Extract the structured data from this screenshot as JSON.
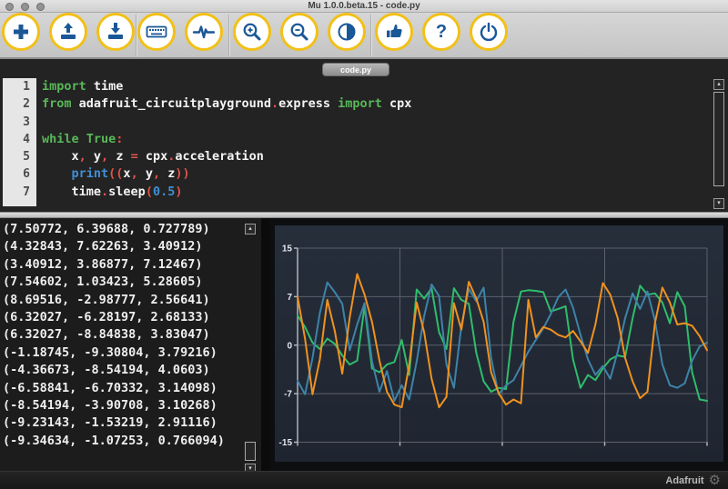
{
  "window": {
    "title": "Mu 1.0.0.beta.15 - code.py",
    "traffic_lights": [
      "close",
      "minimize",
      "zoom"
    ]
  },
  "toolbar": {
    "buttons": [
      {
        "id": "new",
        "icon": "plus-icon"
      },
      {
        "id": "load",
        "icon": "upload-icon"
      },
      {
        "id": "save",
        "icon": "download-icon"
      },
      {
        "id": "serial",
        "icon": "keyboard-icon"
      },
      {
        "id": "plotter",
        "icon": "pulse-icon"
      },
      {
        "id": "zoom-in",
        "icon": "magnifier-plus-icon"
      },
      {
        "id": "zoom-out",
        "icon": "magnifier-minus-icon"
      },
      {
        "id": "theme",
        "icon": "contrast-icon"
      },
      {
        "id": "check",
        "icon": "thumbs-up-icon"
      },
      {
        "id": "help",
        "icon": "question-icon",
        "glyph": "?"
      },
      {
        "id": "quit",
        "icon": "power-icon"
      }
    ]
  },
  "editor": {
    "tab": "code.py",
    "lines": [
      {
        "n": "1",
        "tokens": [
          [
            "k",
            "import"
          ],
          [
            "t",
            " time"
          ]
        ]
      },
      {
        "n": "2",
        "tokens": [
          [
            "k",
            "from"
          ],
          [
            "t",
            " adafruit_circuitplayground"
          ],
          [
            "p",
            "."
          ],
          [
            "t",
            "express "
          ],
          [
            "k",
            "import"
          ],
          [
            "t",
            " cpx"
          ]
        ]
      },
      {
        "n": "3",
        "tokens": []
      },
      {
        "n": "4",
        "tokens": [
          [
            "k",
            "while"
          ],
          [
            "t",
            " "
          ],
          [
            "k",
            "True"
          ],
          [
            "p",
            ":"
          ]
        ]
      },
      {
        "n": "5",
        "tokens": [
          [
            "t",
            "    x"
          ],
          [
            "p",
            ","
          ],
          [
            "t",
            " y"
          ],
          [
            "p",
            ","
          ],
          [
            "t",
            " z "
          ],
          [
            "p",
            "="
          ],
          [
            "t",
            " cpx"
          ],
          [
            "p",
            "."
          ],
          [
            "t",
            "acceleration"
          ]
        ]
      },
      {
        "n": "6",
        "tokens": [
          [
            "t",
            "    "
          ],
          [
            "b",
            "print"
          ],
          [
            "p",
            "(("
          ],
          [
            "t",
            "x"
          ],
          [
            "p",
            ","
          ],
          [
            "t",
            " y"
          ],
          [
            "p",
            ","
          ],
          [
            "t",
            " z"
          ],
          [
            "p",
            "))"
          ]
        ]
      },
      {
        "n": "7",
        "tokens": [
          [
            "t",
            "    time"
          ],
          [
            "p",
            "."
          ],
          [
            "t",
            "sleep"
          ],
          [
            "p",
            "("
          ],
          [
            "b",
            "0.5"
          ],
          [
            "p",
            ")"
          ]
        ]
      }
    ]
  },
  "repl": {
    "lines": [
      "(7.50772, 6.39688, 0.727789)",
      "(4.32843, 7.62263, 3.40912)",
      "(3.40912, 3.86877, 7.12467)",
      "(7.54602, 1.03423, 5.28605)",
      "(8.69516, -2.98777, 2.56641)",
      "(6.32027, -6.28197, 2.68133)",
      "(6.32027, -8.84838, 3.83047)",
      "(-1.18745, -9.30804, 3.79216)",
      "(-4.36673, -8.54194, 4.0603)",
      "(-6.58841, -6.70332, 3.14098)",
      "(-8.54194, -3.90708, 3.10268)",
      "(-9.23143, -1.53219, 2.91116)",
      "(-9.34634, -1.07253, 0.766094)"
    ]
  },
  "chart_data": {
    "type": "line",
    "title": "",
    "xlabel": "",
    "ylabel": "",
    "ylim": [
      -15,
      15
    ],
    "ytick_labels": [
      "15",
      "7",
      "0",
      "-7",
      "-15"
    ],
    "x_gridline_count": 5,
    "grid": true,
    "legend": false,
    "background": "#232a36",
    "gridline_color": "#5c616b",
    "series": [
      {
        "name": "green",
        "color": "#2fbd6b",
        "values": [
          4.6,
          2.8,
          0.4,
          -0.6,
          1.0,
          0.2,
          -1.6,
          -3.0,
          -2.4,
          6.0,
          -3.6,
          -4.2,
          -3.0,
          -2.6,
          0.8,
          -4.6,
          8.6,
          7.2,
          8.8,
          2.0,
          -0.6,
          8.8,
          7.0,
          6.4,
          -1.2,
          -5.6,
          -7.2,
          -6.6,
          -6.8,
          3.6,
          8.3,
          8.5,
          8.4,
          8.2,
          5.2,
          5.6,
          6.0,
          -2.2,
          -6.6,
          -4.6,
          -5.4,
          -3.6,
          -2.2,
          -1.6,
          -1.8,
          4.2,
          9.2,
          7.8,
          8.0,
          6.6,
          3.4,
          8.2,
          6.0,
          -4.2,
          -8.4,
          -8.6
        ]
      },
      {
        "name": "blue",
        "color": "#3e83a8",
        "values": [
          -5.5,
          -7.6,
          -2.0,
          5.0,
          9.7,
          8.2,
          6.4,
          -0.8,
          3.2,
          6.5,
          -2.5,
          -7.2,
          -4.0,
          -8.6,
          -6.2,
          -8.4,
          -2.5,
          4.5,
          9.4,
          7.6,
          -3.0,
          -6.6,
          3.0,
          8.7,
          6.8,
          8.9,
          -2.0,
          -7.6,
          -6.2,
          -5.4,
          -3.2,
          -1.0,
          0.8,
          2.6,
          4.8,
          7.4,
          8.6,
          5.8,
          1.6,
          -2.2,
          -4.6,
          -3.2,
          -5.2,
          -1.0,
          4.2,
          8.0,
          5.6,
          8.3,
          3.8,
          -3.0,
          -6.2,
          -6.6,
          -5.9,
          -2.4,
          -0.2,
          0.4
        ]
      },
      {
        "name": "orange",
        "color": "#f0921e",
        "values": [
          7.5,
          1.0,
          -7.6,
          -2.2,
          7.0,
          2.2,
          -4.4,
          4.3,
          11.0,
          7.8,
          3.6,
          -2.4,
          -7.2,
          -9.2,
          -9.6,
          -3.0,
          6.6,
          2.0,
          -5.2,
          -9.6,
          -8.0,
          6.5,
          2.4,
          9.8,
          7.2,
          3.6,
          -4.2,
          -7.4,
          -9.2,
          -8.4,
          -9.0,
          7.0,
          1.2,
          2.8,
          2.4,
          1.6,
          1.2,
          2.2,
          0.6,
          -1.2,
          3.2,
          9.6,
          7.8,
          4.2,
          -2.0,
          -5.6,
          -8.2,
          -7.2,
          3.4,
          8.9,
          6.6,
          3.2,
          3.4,
          3.0,
          1.4,
          -0.8
        ]
      }
    ]
  },
  "statusbar": {
    "mode_label": "Adafruit",
    "gear_icon": "gear-icon",
    "gear_glyph": "⚙"
  }
}
